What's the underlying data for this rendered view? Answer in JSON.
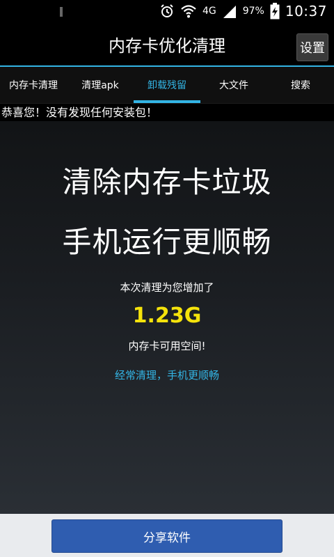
{
  "status_bar": {
    "network": "4G",
    "battery": "97%",
    "time": "10:37",
    "icons": [
      "alarm-icon",
      "wifi-icon",
      "signal-icon",
      "battery-charging-icon"
    ]
  },
  "header": {
    "title": "内存卡优化清理",
    "settings_label": "设置"
  },
  "tabs": [
    {
      "label": "内存卡清理"
    },
    {
      "label": "清理apk"
    },
    {
      "label": "卸载残留",
      "active": true
    },
    {
      "label": "大文件"
    },
    {
      "label": "搜索"
    }
  ],
  "notice": "恭喜您！没有发现任何安装包！",
  "main": {
    "headline1": "清除内存卡垃圾",
    "headline2": "手机运行更顺畅",
    "sub1": "本次清理为您增加了",
    "amount": "1.23G",
    "sub2": "内存卡可用空间!",
    "tip": "经常清理，手机更顺畅"
  },
  "footer": {
    "share_label": "分享软件"
  },
  "colors": {
    "accent": "#33b5e5",
    "amount": "#f5e30b",
    "share_button": "#2f5db0"
  }
}
